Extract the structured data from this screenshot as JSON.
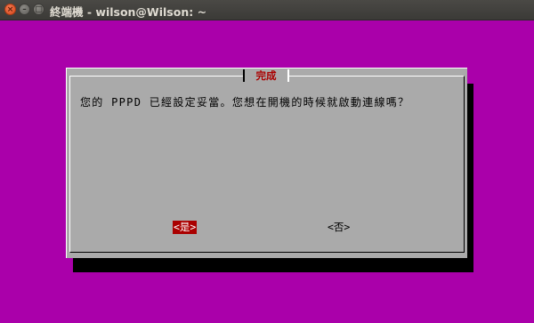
{
  "window": {
    "title": "終端機 - wilson@Wilson: ~",
    "close_glyph": "×",
    "minimize_glyph": "–",
    "maximize_glyph": "□",
    "background_color": "#aa00aa"
  },
  "dialog": {
    "title": "完成",
    "message": "您的 PPPD 已經設定妥當。您想在開機的時候就啟動連線嗎？",
    "buttons": {
      "yes_label": "<是>",
      "no_label": "<否>"
    },
    "colors": {
      "body": "#aaaaaa",
      "accent": "#aa0000",
      "shadow": "#000000"
    }
  }
}
